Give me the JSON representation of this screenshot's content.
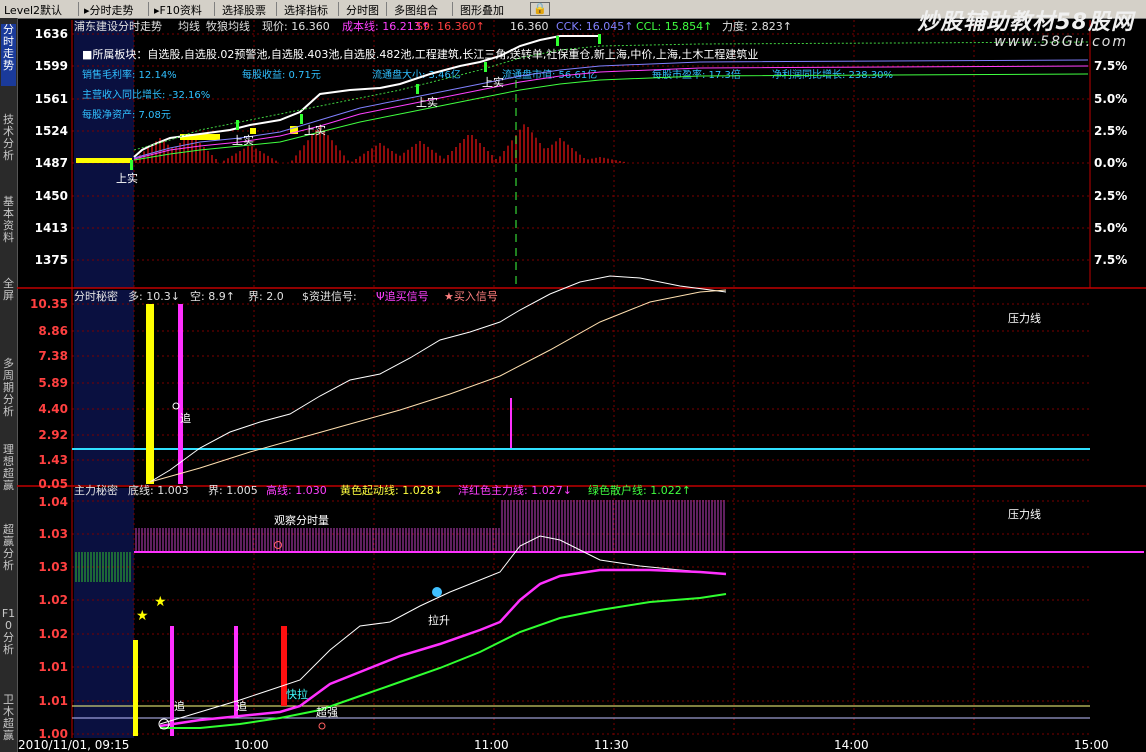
{
  "toolbar": {
    "items": [
      "Level2默认",
      "分时走势",
      "F10资料",
      "选择股票",
      "选择指标",
      "分时图",
      "多图组合",
      "图形叠加"
    ]
  },
  "brand": {
    "title": "炒股辅助教材58股网",
    "url": "www.58Gu.com"
  },
  "sidetabs": [
    "分时走势",
    "技术分析",
    "基本资料",
    "全屏",
    "多周期分析",
    "理想超赢",
    "超赢分析",
    "F10分析",
    "卫木超赢"
  ],
  "panel1": {
    "header": {
      "name": "浦东建设分时走势",
      "avg_label": "均线",
      "ma_label": "牧狼均线",
      "price": "现价: 16.360",
      "cost": "成本线: 16.213↑",
      "s9": "S9: 16.360↑",
      "val": "16.360",
      "ccl1": "CCK: 16.045↑",
      "ccl2": "CCL: 15.854↑",
      "force": "力度: 2.823↑"
    },
    "info": {
      "sector": "■所属板块：自选股,自选股.02预警池,自选股.403池,自选股.482池,工程建筑,长江三角,送转单,社保重仓,新上海,中价,上海,土木工程建筑业",
      "r1": [
        "销售毛利率: 12.14%",
        "每股收益: 0.71元",
        "流通盘大小: 3.46亿",
        "流通盘市值: 56.61亿",
        "每股市盈率: 17.3倍",
        "净利润同比增长: 238.30%"
      ],
      "r2": "主营收入同比增长: -32.16%",
      "r3": "每股净资产: 7.08元"
    },
    "left_axis": [
      "1636",
      "1599",
      "1561",
      "1524",
      "1487",
      "1450",
      "1413",
      "1375"
    ],
    "right_axis": [
      "7.5%",
      "5.0%",
      "2.5%",
      "0.0%",
      "2.5%",
      "5.0%",
      "7.5%"
    ],
    "tags": [
      "上实",
      "上实",
      "上实",
      "上实",
      "上实"
    ]
  },
  "panel2": {
    "header": {
      "name": "分时秘密",
      "duo": "多: 10.3↓",
      "kong": "空: 8.9↑",
      "jie": "界: 2.0",
      "signal": "$资进信号:",
      "chase": "Ψ追买信号",
      "star": "★买入信号"
    },
    "left_axis": [
      "10.35",
      "8.86",
      "7.38",
      "5.89",
      "4.40",
      "2.92",
      "1.43",
      "0.05"
    ],
    "right_label": "压力线",
    "tag": "追"
  },
  "panel3": {
    "header": {
      "name": "主力秘密",
      "di": "底线: 1.003",
      "jie": "界: 1.005",
      "high": "高线: 1.030",
      "yellow": "黄色起动线: 1.028↓",
      "red": "洋红色主力线: 1.027↓",
      "green": "绿色散户线: 1.022↑"
    },
    "left_axis": [
      "1.04",
      "1.03",
      "1.03",
      "1.02",
      "1.02",
      "1.01",
      "1.01",
      "1.00"
    ],
    "right_label": "压力线",
    "notes": {
      "watch": "观察分时量",
      "pull": "拉升",
      "fast": "快拉",
      "super": "超强",
      "chase": "追",
      "chase2": "追"
    }
  },
  "time_axis": [
    "2010/11/01, 09:15",
    "10:00",
    "11:00",
    "11:30",
    "14:00",
    "15:00"
  ],
  "colors": {
    "grid": "#8b0000",
    "axis_red": "#ff3030",
    "yellow": "#ffff00",
    "magenta": "#ff30ff",
    "green": "#30ff30",
    "cyan": "#30e0ff",
    "white": "#ffffff"
  }
}
